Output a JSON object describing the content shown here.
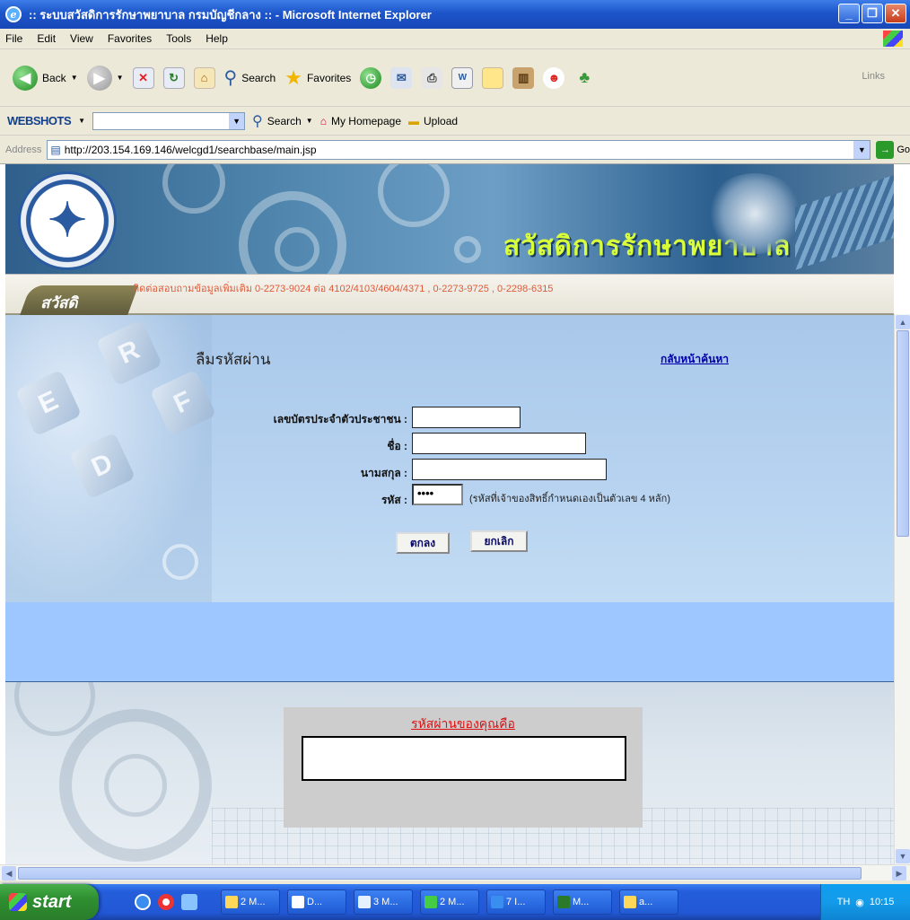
{
  "window": {
    "title": ":: ระบบสวัสดิการรักษาพยาบาล กรมบัญชีกลาง :: - Microsoft Internet Explorer",
    "min": "_",
    "max": "❐",
    "close": "✕"
  },
  "menu": [
    "File",
    "Edit",
    "View",
    "Favorites",
    "Tools",
    "Help"
  ],
  "toolbar": {
    "back": "Back",
    "search": "Search",
    "favorites": "Favorites",
    "links": "Links"
  },
  "websearch": {
    "logo": "WEBSHOTS",
    "search": "Search",
    "homepage": "My Homepage",
    "upload": "Upload"
  },
  "address": {
    "label": "Address",
    "url": "http://203.154.169.146/welcgd1/searchbase/main.jsp",
    "go": "Go"
  },
  "banner": {
    "title": "สวัสดิการรักษาพยาบาล",
    "menu_tab": "สวัสดิ",
    "contact": "ติดต่อสอบถามข้อมูลเพิ่มเติม 0-2273-9024 ต่อ 4102/4103/4604/4371 , 0-2273-9725 , 0-2298-6315"
  },
  "form": {
    "title": "ลืมรหัสผ่าน",
    "back_link": "กลับหน้าค้นหา",
    "id_label": "เลขบัตรประจำตัวประชาชน :",
    "name_label": "ชื่อ :",
    "surname_label": "นามสกุล :",
    "code_label": "รหัส :",
    "code_value": "••••",
    "code_note": "(รหัสที่เจ้าของสิทธิ์กำหนดเองเป็นตัวเลข 4 หลัก)",
    "ok_button": "ตกลง",
    "cancel_button": "ยกเลิก"
  },
  "result": {
    "title": "รหัสผ่านของคุณคือ"
  },
  "taskbar": {
    "start": "start",
    "tasks": [
      "2 M...",
      "D...",
      "3 M...",
      "2 M...",
      "7 I...",
      "M...",
      "a..."
    ],
    "lang": "TH",
    "clock": "10:15"
  }
}
